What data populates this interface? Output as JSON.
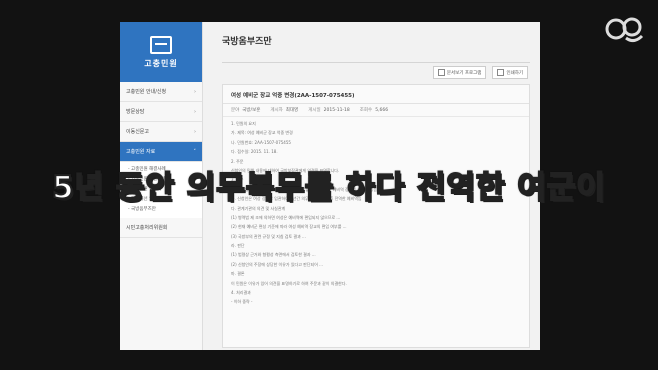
{
  "sidebar": {
    "title": "고충민원",
    "items": [
      {
        "label": "고충민원 안내/신청",
        "arrow": "›"
      },
      {
        "label": "방문상담",
        "arrow": "›"
      },
      {
        "label": "이동신문고",
        "arrow": "›"
      },
      {
        "label": "고충민원 자료",
        "arrow": "˅",
        "active": true
      }
    ],
    "sub_items": [
      "- 고충민원 해결사례",
      "- 고충민원 의결사례",
      "- 고충민원 결정례",
      "- 정책개선 권고",
      "- 국방옴부즈만"
    ],
    "bottom_item": "시민고충처리위원회"
  },
  "main": {
    "title": "국방옴부즈만",
    "tools": [
      "문서보기 프로그램",
      "인쇄하기"
    ]
  },
  "doc": {
    "title": "여성 예비군 장교 억중 변경(2AA-1507-075455)",
    "meta": [
      {
        "k": "분야",
        "v": "국방/보훈"
      },
      {
        "k": "게시자",
        "v": "최대영"
      },
      {
        "k": "게시일",
        "v": "2015-11-18"
      },
      {
        "k": "조회수",
        "v": "5,666"
      }
    ],
    "lines": [
      "1. 민원의 요지",
      "가. 제목: 여성 예비군 장교 억중 변경",
      "나. 민원번호: 2AA-1507-075455",
      "다. 접수일: 2015. 11. 18.",
      "2. 주문",
      "신청인의 민원 내용에 대하여 국방부장관에게 의견을 표명합니다.",
      "3. 이유",
      "가. 신청원인 (병원 서류 보완) 이후 의무복무를 마친 후 여성 예비역 장교를 원하고 있음",
      "나. 신청인은 여성 장교로 임관하여 5년간 의무복무를 마친 후 전역한 예비역임",
      "다. 관계기관의 의견 및 사실관계",
      "(1) 병역법 제 조에 의하면 여성은 예비역에 편입되지 않으므로 ...",
      "(2) 현재 예비군 편성 기준에 따라 여성 예비역 장교의 편입 여부를 ...",
      "(3) 국방부의 관련 규정 및 지침 검토 결과 ...",
      "라. 판단",
      "(1) 법령상 근거와 형평성 측면에서 검토한 결과 ...",
      "(2) 신청인의 주장에 상당한 이유가 있다고 판단되어 ...",
      "마. 결론",
      "이 민원은 이유가 있어 의견을 표명하기로 하여 주문과 같이 의결한다.",
      "4. 처리결과",
      "- 이하 중략 -"
    ]
  },
  "caption": "5년 동안 의무복무를 하다 전역한 여군이",
  "colors": {
    "accent": "#2f74c0",
    "background": "#121212"
  },
  "logo": "channel-logo-icon"
}
